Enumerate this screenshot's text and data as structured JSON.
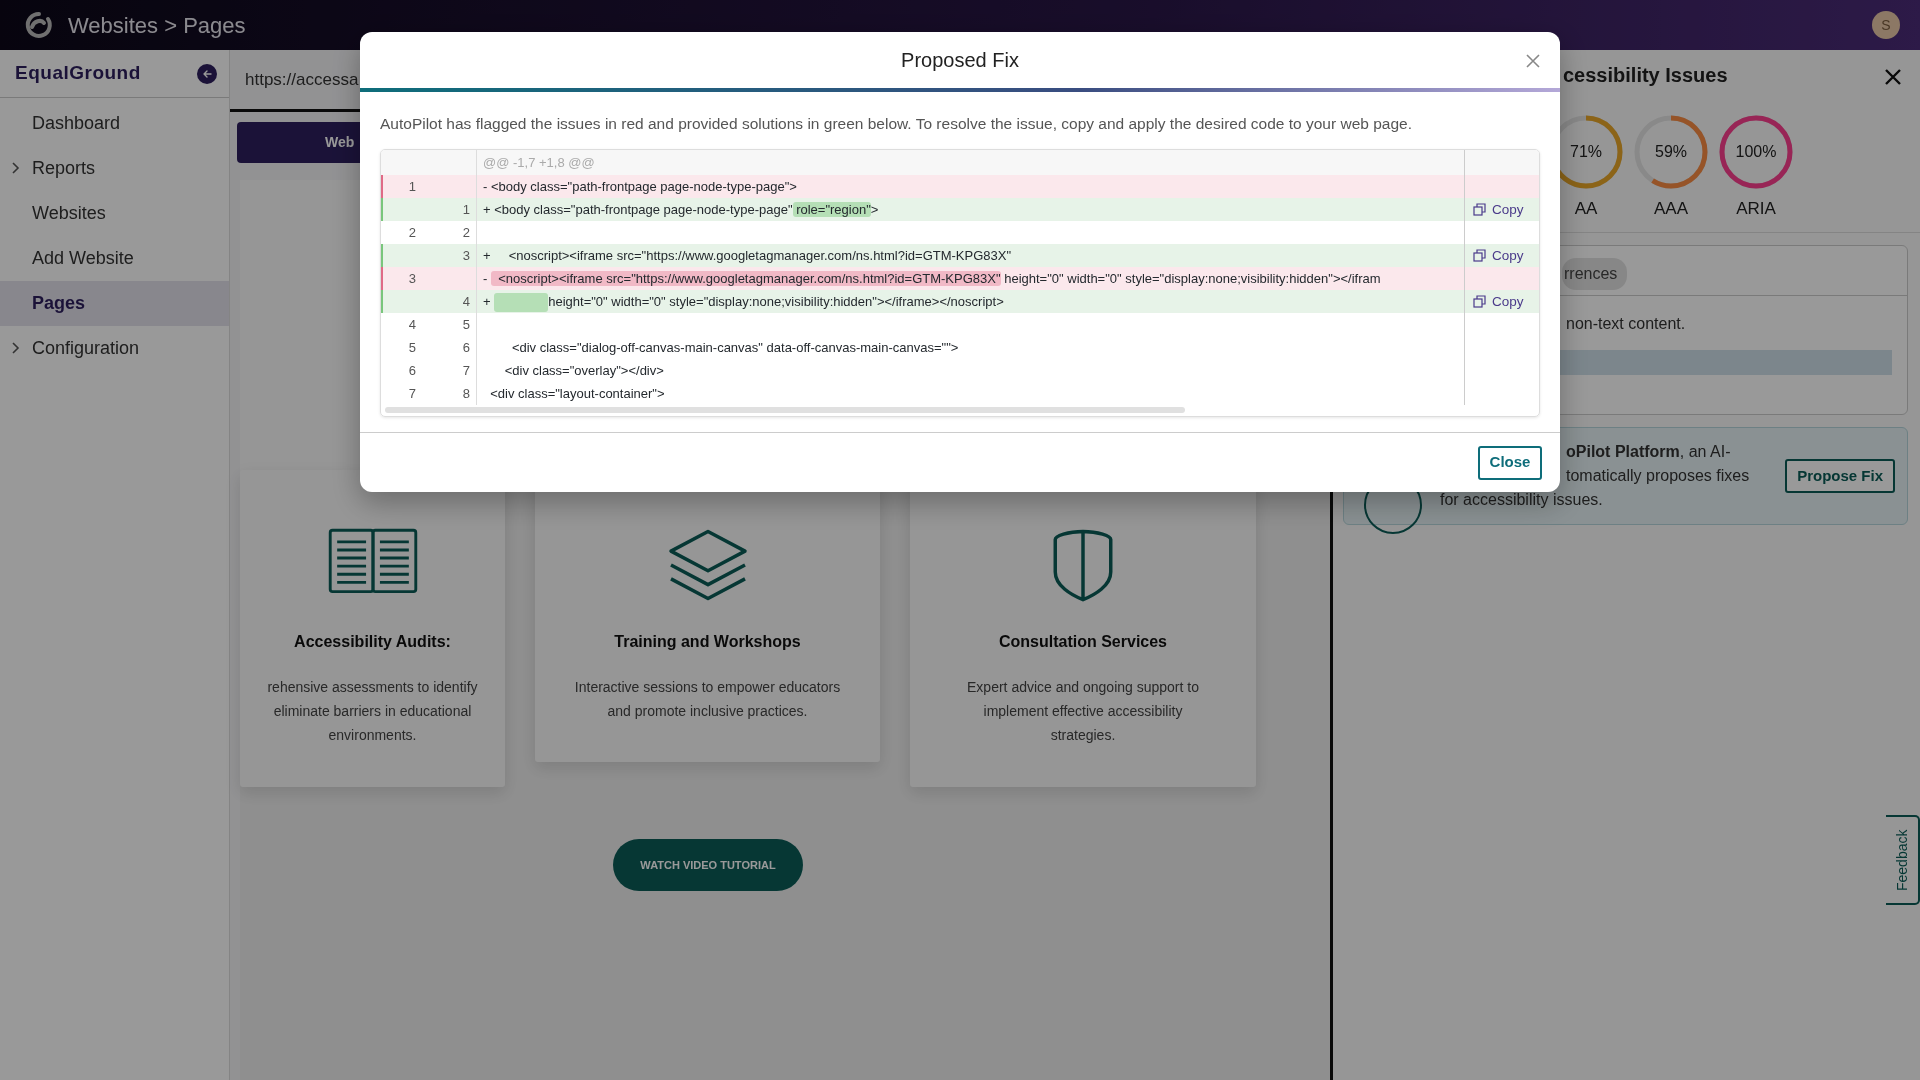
{
  "topbar": {
    "title": "Websites > Pages",
    "avatar": "S"
  },
  "sidebar": {
    "brand": "EqualGround",
    "items": [
      {
        "label": "Dashboard",
        "expandable": false,
        "selected": false
      },
      {
        "label": "Reports",
        "expandable": true,
        "selected": false
      },
      {
        "label": "Websites",
        "expandable": false,
        "selected": false
      },
      {
        "label": "Add Website",
        "expandable": false,
        "selected": false
      },
      {
        "label": "Pages",
        "expandable": false,
        "selected": true
      },
      {
        "label": "Configuration",
        "expandable": true,
        "selected": false
      }
    ]
  },
  "main": {
    "url": "https://accessa",
    "tabs": [
      {
        "label": "Web",
        "selected": true
      }
    ],
    "cards": [
      {
        "kind": "book",
        "title": "Accessibility Audits:",
        "lines": [
          "rehensive assessments to identify",
          "eliminate barriers in educational",
          "environments."
        ]
      },
      {
        "kind": "layers",
        "title": "Training and Workshops",
        "lines": [
          "Interactive sessions to empower educators",
          "and promote inclusive practices."
        ]
      },
      {
        "kind": "shield",
        "title": "Consultation Services",
        "lines": [
          "Expert advice and ongoing support to",
          "implement effective accessibility",
          "strategies."
        ]
      }
    ],
    "video_button": "WATCH VIDEO TUTORIAL"
  },
  "issues_panel": {
    "title": "cessibility Issues",
    "scores": [
      {
        "value": "71%",
        "label": "AA",
        "level": 0.71,
        "color": "#8c6418"
      },
      {
        "value": "59%",
        "label": "AAA",
        "level": 0.59,
        "color": "#965428"
      },
      {
        "value": "100%",
        "label": "ARIA",
        "level": 1,
        "color": "#982656"
      }
    ],
    "tab": "rrences",
    "description": "non-text content.",
    "banner": {
      "lines": [
        "**oPilot Platform**, an AI-",
        "tomatically proposes fixes",
        "for accessibility issues."
      ],
      "button": "Propose Fix"
    }
  },
  "feedback": "Feedback",
  "modal": {
    "title": "Proposed Fix",
    "intro": "AutoPilot has flagged the issues in red and provided solutions in green below. To resolve the issue, copy and apply the desired code to your web page.",
    "diff": {
      "hunk": "@@ -1,7 +1,8 @@",
      "rows": [
        {
          "kind": "del",
          "old": "1",
          "sign": "-",
          "code": [
            {
              "text": "<body class=\"path-frontpage page-node-type-page\">",
              "mark": false
            }
          ]
        },
        {
          "kind": "add",
          "new": "1",
          "sign": "+",
          "code": [
            {
              "text": "<body class=\"path-frontpage page-node-type-page\"",
              "mark": false
            },
            {
              "text": " role=\"region\"",
              "mark": true
            },
            {
              "text": ">",
              "mark": false
            }
          ],
          "copy": "Copy"
        },
        {
          "kind": "context",
          "old": "2",
          "new": "2"
        },
        {
          "kind": "add",
          "new": "3",
          "sign": "+",
          "code": [
            {
              "text": "    <noscript><iframe src=\"https://www.googletagmanager.com/ns.html?id=GTM-KPG83X\"",
              "mark": false
            }
          ],
          "copy": "Copy"
        },
        {
          "kind": "del",
          "old": "3",
          "sign": "-",
          "code": [
            {
              "text": "  <noscript><iframe src=\"https://www.googletagmanager.com/ns.html?id=GTM-KPG83X\"",
              "mark": true
            },
            {
              "text": " height=\"0\" width=\"0\" style=\"display:none;visibility:hidden\"></ifram",
              "mark": false
            }
          ]
        },
        {
          "kind": "add",
          "new": "4",
          "sign": "+",
          "leading_mark": true,
          "code": [
            {
              "text": "height=\"0\" width=\"0\" style=\"display:none;visibility:hidden\"></iframe></noscript>",
              "mark": false
            }
          ],
          "copy": "Copy"
        },
        {
          "kind": "context",
          "old": "4",
          "new": "5"
        },
        {
          "kind": "context",
          "old": "5",
          "new": "6",
          "code": [
            {
              "text": "        <div class=\"dialog-off-canvas-main-canvas\" data-off-canvas-main-canvas=\"\">",
              "mark": false
            }
          ]
        },
        {
          "kind": "context",
          "old": "6",
          "new": "7",
          "code": [
            {
              "text": "      <div class=\"overlay\"></div>",
              "mark": false
            }
          ]
        },
        {
          "kind": "context",
          "old": "7",
          "new": "8",
          "code": [
            {
              "text": "  <div class=\"layout-container\">",
              "mark": false
            }
          ]
        }
      ]
    },
    "close": "Close"
  }
}
